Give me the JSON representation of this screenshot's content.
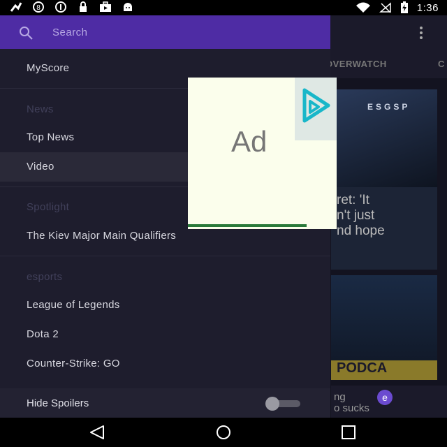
{
  "status_bar": {
    "time": "1:36",
    "icons_left": [
      "app-notification-icon",
      "number-8-icon",
      "info-icon",
      "lock-icon",
      "briefcase-icon",
      "android-icon"
    ],
    "icons_right": [
      "wifi-icon",
      "no-signal-icon",
      "battery-charging-icon"
    ]
  },
  "drawer": {
    "search_label": "Search",
    "items": [
      {
        "label": "MyScore"
      },
      {
        "label": "Top News"
      },
      {
        "label": "Video"
      },
      {
        "label": "The Kiev Major Main Qualifiers"
      },
      {
        "label": "League of Legends"
      },
      {
        "label": "Dota 2"
      },
      {
        "label": "Counter-Strike: GO"
      }
    ],
    "sections": {
      "news": "News",
      "spotlight": "Spotlight",
      "esports": "esports"
    },
    "footer": {
      "label": "Hide Spoilers",
      "toggle_on": false
    },
    "selected_item": "Video"
  },
  "background": {
    "tabs": [
      "OVERWATCH",
      "C"
    ],
    "card1_headline_lines": [
      "ret: 'It",
      "n't just",
      "nd hope"
    ],
    "card1_sponsor": "ESGSP",
    "card2_strip": "PODCA",
    "card3_lines": [
      "ng",
      "o sucks"
    ],
    "card3_logo": "e"
  },
  "ad": {
    "label": "Ad"
  },
  "colors": {
    "drawer_header": "#4e2ca4",
    "drawer_bg": "#1e1d2d",
    "accent": "#4e2ca4"
  }
}
